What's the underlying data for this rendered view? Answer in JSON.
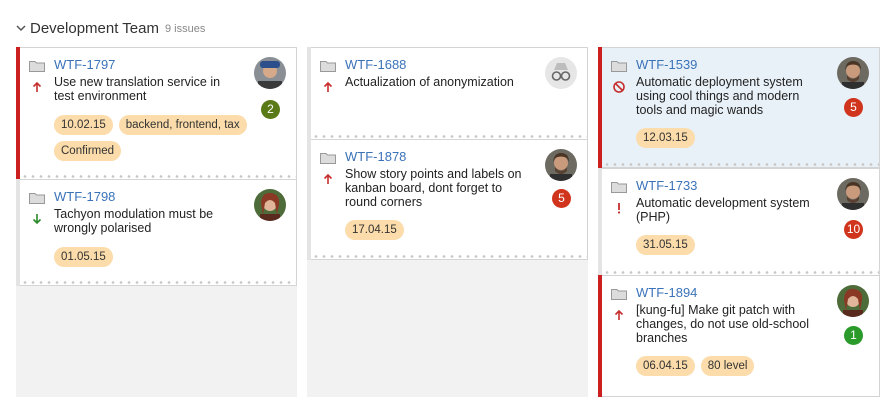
{
  "group": {
    "title": "Development Team",
    "count": "9 issues"
  },
  "colors": {
    "flag": "#cc1f1f",
    "link": "#3b73b9",
    "chip": "#fbdcaa",
    "badge_red": "#d0341c",
    "badge_olive": "#5a7a17",
    "badge_green": "#2a9a2a",
    "highlight": "#e9f1f8"
  },
  "cards": {
    "c1797": {
      "key": "WTF-1797",
      "summary": [
        "Use new translation service in",
        "test environment"
      ],
      "priority_icon": "arrow-up-icon",
      "badge": "2",
      "chips": [
        "10.02.15",
        "backend, frontend, tax",
        "Confirmed"
      ]
    },
    "c1798": {
      "key": "WTF-1798",
      "summary": [
        "Tachyon modulation must be",
        "wrongly polarised"
      ],
      "priority_icon": "arrow-down-icon",
      "chips": [
        "01.05.15"
      ]
    },
    "c1688": {
      "key": "WTF-1688",
      "summary": [
        "Actualization of anonymization"
      ],
      "priority_icon": "arrow-up-icon"
    },
    "c1878": {
      "key": "WTF-1878",
      "summary": [
        "Show story points and labels on",
        "kanban board, dont forget to",
        "round corners"
      ],
      "priority_icon": "arrow-up-icon",
      "badge": "5",
      "chips": [
        "17.04.15"
      ]
    },
    "c1539": {
      "key": "WTF-1539",
      "summary": [
        "Automatic deployment system",
        "using cool things and modern",
        "tools and magic wands"
      ],
      "priority_icon": "blocked-icon",
      "badge": "5",
      "chips": [
        "12.03.15"
      ]
    },
    "c1733": {
      "key": "WTF-1733",
      "summary": [
        "Automatic development system",
        "(PHP)"
      ],
      "priority_icon": "exclamation-icon",
      "badge": "10",
      "chips": [
        "31.05.15"
      ]
    },
    "c1894": {
      "key": "WTF-1894",
      "summary": [
        "[kung-fu] Make git patch with",
        "changes, do not use old-school",
        "branches"
      ],
      "priority_icon": "arrow-up-icon",
      "badge": "1",
      "chips": [
        "06.04.15",
        "80 level"
      ]
    }
  }
}
